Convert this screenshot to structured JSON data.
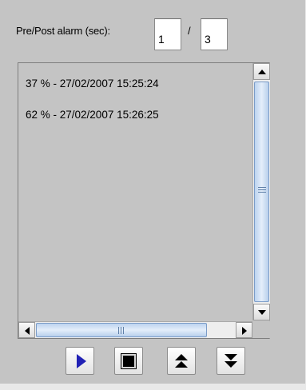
{
  "alarm": {
    "label": "Pre/Post alarm (sec):",
    "pre_value": "1",
    "separator": "/",
    "post_value": "3"
  },
  "events": [
    {
      "text": "37 % - 27/02/2007 15:25:24"
    },
    {
      "text": "62 % - 27/02/2007 15:26:25"
    }
  ],
  "controls": {
    "play_icon": "play-icon",
    "stop_icon": "stop-icon",
    "scroll_top_icon": "double-chevron-up-icon",
    "scroll_bottom_icon": "double-chevron-down-icon"
  },
  "colors": {
    "background": "#c4c4c4",
    "play": "#2121b5",
    "scroll_thumb": "#bcd3ef"
  }
}
